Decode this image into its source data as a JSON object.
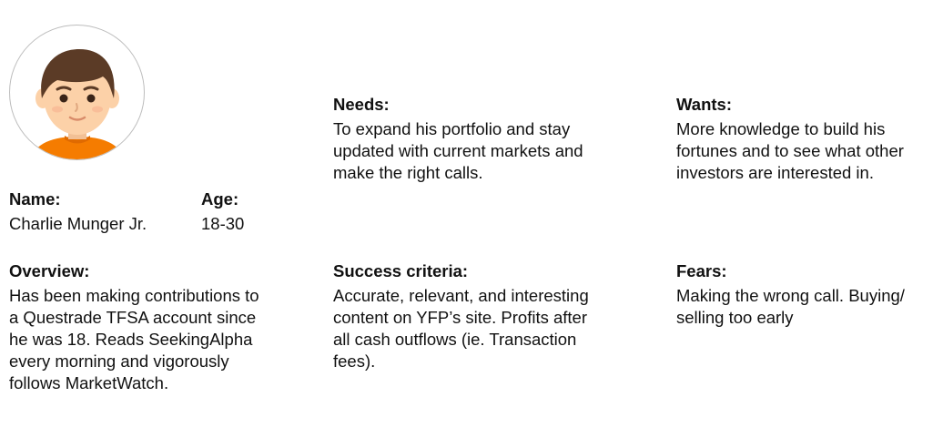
{
  "persona": {
    "avatar_icon": "boy-avatar-icon",
    "name": {
      "label": "Name:",
      "value": "Charlie Munger Jr."
    },
    "age": {
      "label": "Age:",
      "value": "18-30"
    },
    "needs": {
      "label": "Needs:",
      "lines": [
        "To expand his portfolio and stay",
        "updated with current markets and",
        "make the right calls."
      ]
    },
    "wants": {
      "label": "Wants:",
      "lines": [
        "More knowledge to build his",
        "fortunes and to see what other",
        "investors are interested in."
      ]
    },
    "overview": {
      "label": "Overview:",
      "lines": [
        "Has been making contributions to",
        "a Questrade TFSA account since",
        "he was 18. Reads SeekingAlpha",
        "every morning and vigorously",
        "follows MarketWatch."
      ]
    },
    "success": {
      "label": "Success criteria:",
      "lines": [
        "Accurate, relevant, and interesting",
        "content on YFP’s site. Profits after",
        "all cash outflows (ie. Transaction",
        "fees)."
      ]
    },
    "fears": {
      "label": "Fears:",
      "lines": [
        "Making the wrong call. Buying/",
        "selling too early"
      ]
    }
  },
  "colors": {
    "hair": "#5b3b26",
    "skin": "#fcd1a8",
    "shirt": "#f57c00",
    "outline": "#bdbdbd"
  }
}
